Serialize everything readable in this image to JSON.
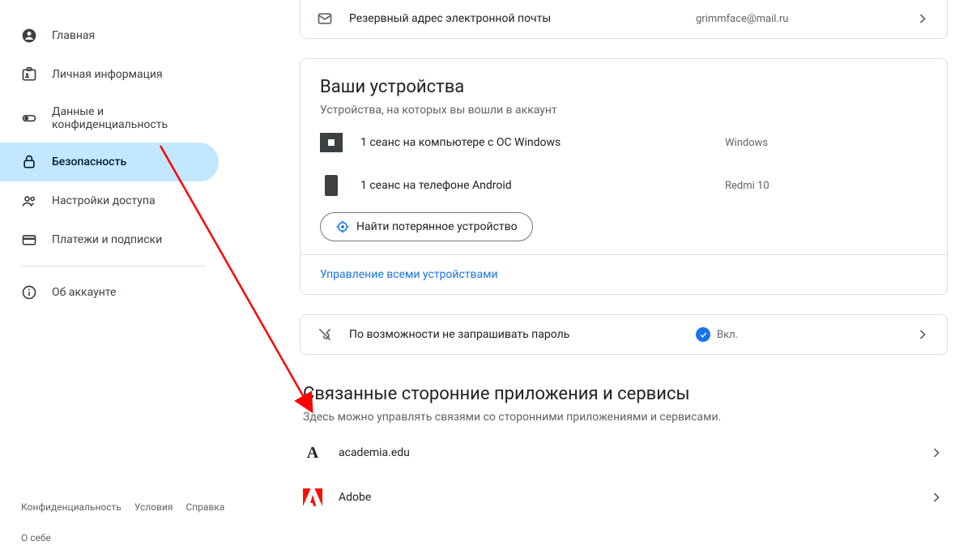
{
  "sidebar": {
    "items": [
      {
        "label": "Главная"
      },
      {
        "label": "Личная информация"
      },
      {
        "label": "Данные и конфиденциальность"
      },
      {
        "label": "Безопасность"
      },
      {
        "label": "Настройки доступа"
      },
      {
        "label": "Платежи и подписки"
      },
      {
        "label": "Об аккаунте"
      }
    ]
  },
  "footer": {
    "privacy": "Конфиденциальность",
    "terms": "Условия",
    "help": "Справка",
    "about": "О себе"
  },
  "recovery": {
    "label": "Резервный адрес электронной почты",
    "value": "grimmface@mail.ru"
  },
  "devices": {
    "title": "Ваши устройства",
    "subtitle": "Устройства, на которых вы вошли в аккаунт",
    "list": [
      {
        "label": "1 сеанс на компьютере с ОС Windows",
        "name": "Windows"
      },
      {
        "label": "1 сеанс на телефоне Android",
        "name": "Redmi 10"
      }
    ],
    "find_button": "Найти потерянное устройство",
    "manage_link": "Управление всеми устройствами"
  },
  "skip_password": {
    "label": "По возможности не запрашивать пароль",
    "status": "Вкл."
  },
  "apps": {
    "title": "Связанные сторонние приложения и сервисы",
    "subtitle": "Здесь можно управлять связями со сторонними приложениями и сервисами.",
    "list": [
      {
        "name": "academia.edu"
      },
      {
        "name": "Adobe"
      }
    ]
  }
}
